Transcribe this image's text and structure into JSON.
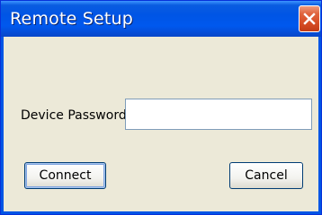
{
  "dialog": {
    "title": "Remote Setup",
    "close_icon": "close-icon",
    "password_label": "Device Password",
    "password_value": "",
    "connect_label": "Connect",
    "cancel_label": "Cancel",
    "colors": {
      "title_bar": "#0055e5",
      "close_button": "#d54b23",
      "body": "#ece9d8"
    }
  }
}
